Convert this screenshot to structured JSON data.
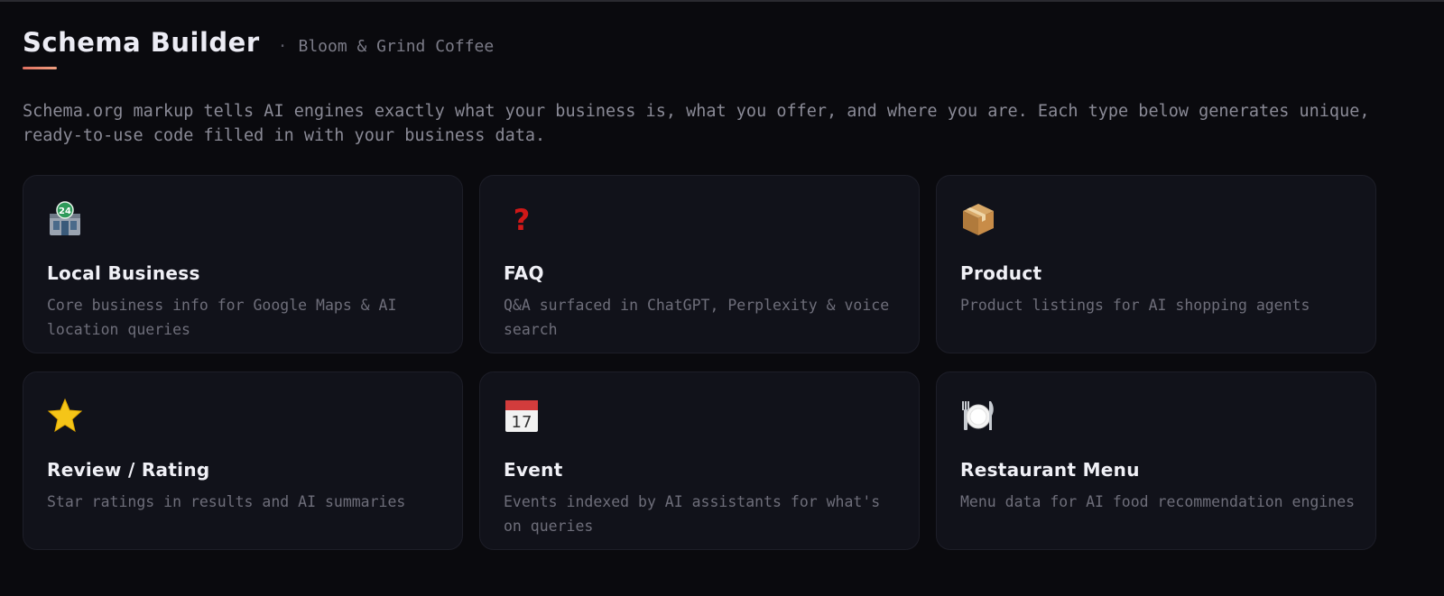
{
  "header": {
    "title": "Schema Builder",
    "separator": "·",
    "business_name": "Bloom & Grind Coffee",
    "accent_color": "#e07060"
  },
  "intro": "Schema.org markup tells AI engines exactly what your business is, what you offer, and where you are. Each type below generates unique, ready-to-use code filled in with your business data.",
  "cards": [
    {
      "icon": "convenience-store-icon",
      "title": "Local Business",
      "description": "Core business info for Google Maps & AI location queries"
    },
    {
      "icon": "question-mark-icon",
      "title": "FAQ",
      "description": "Q&A surfaced in ChatGPT, Perplexity & voice search"
    },
    {
      "icon": "package-icon",
      "title": "Product",
      "description": "Product listings for AI shopping agents"
    },
    {
      "icon": "star-icon",
      "title": "Review / Rating",
      "description": "Star ratings in results and AI summaries"
    },
    {
      "icon": "calendar-icon",
      "title": "Event",
      "description": "Events indexed by AI assistants for what's on queries"
    },
    {
      "icon": "plate-cutlery-icon",
      "title": "Restaurant Menu",
      "description": "Menu data for AI food recommendation engines"
    }
  ]
}
